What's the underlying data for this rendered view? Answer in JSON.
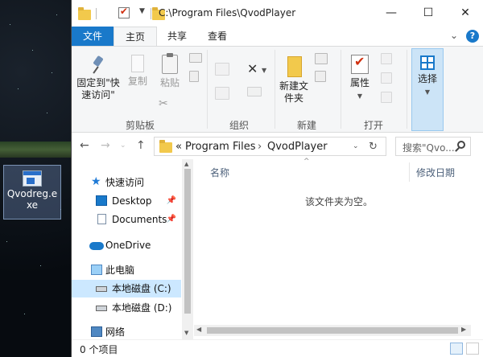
{
  "desktop": {
    "icon_label": "Qvodreg.exe"
  },
  "window": {
    "path_title": "C:\\Program Files\\QvodPlayer",
    "controls": {
      "minimize": "—",
      "maximize": "☐",
      "close": "✕"
    }
  },
  "ribbon_tabs": [
    {
      "label": "文件"
    },
    {
      "label": "主页"
    },
    {
      "label": "共享"
    },
    {
      "label": "查看"
    }
  ],
  "ribbon": {
    "pin_quick": "固定到\"快速访问\"",
    "copy": "复制",
    "paste": "粘贴",
    "clipboard_group": "剪贴板",
    "organize_group": "组织",
    "new_folder": "新建文件夹",
    "new_group": "新建",
    "properties": "属性",
    "open_group": "打开",
    "select": "选择"
  },
  "address": {
    "overflow": "«",
    "crumbs": [
      "Program Files",
      "QvodPlayer"
    ],
    "search_placeholder": "搜索\"Qvo..."
  },
  "nav_pane": {
    "items": [
      {
        "label": "快速访问",
        "icon": "star-icon"
      },
      {
        "label": "Desktop",
        "icon": "desktop-icon",
        "pinned": true
      },
      {
        "label": "Documents",
        "icon": "documents-icon",
        "pinned": true
      },
      {
        "label": "OneDrive",
        "icon": "cloud-icon"
      },
      {
        "label": "此电脑",
        "icon": "pc-icon"
      },
      {
        "label": "本地磁盘 (C:)",
        "icon": "drive-icon",
        "selected": true
      },
      {
        "label": "本地磁盘 (D:)",
        "icon": "drive-icon"
      },
      {
        "label": "网络",
        "icon": "network-icon"
      }
    ]
  },
  "content": {
    "col_name": "名称",
    "col_modified": "修改日期",
    "empty_message": "该文件夹为空。"
  },
  "status": {
    "item_count": "0 个项目"
  },
  "colors": {
    "accent": "#1979ca",
    "selection": "#cce8ff"
  }
}
